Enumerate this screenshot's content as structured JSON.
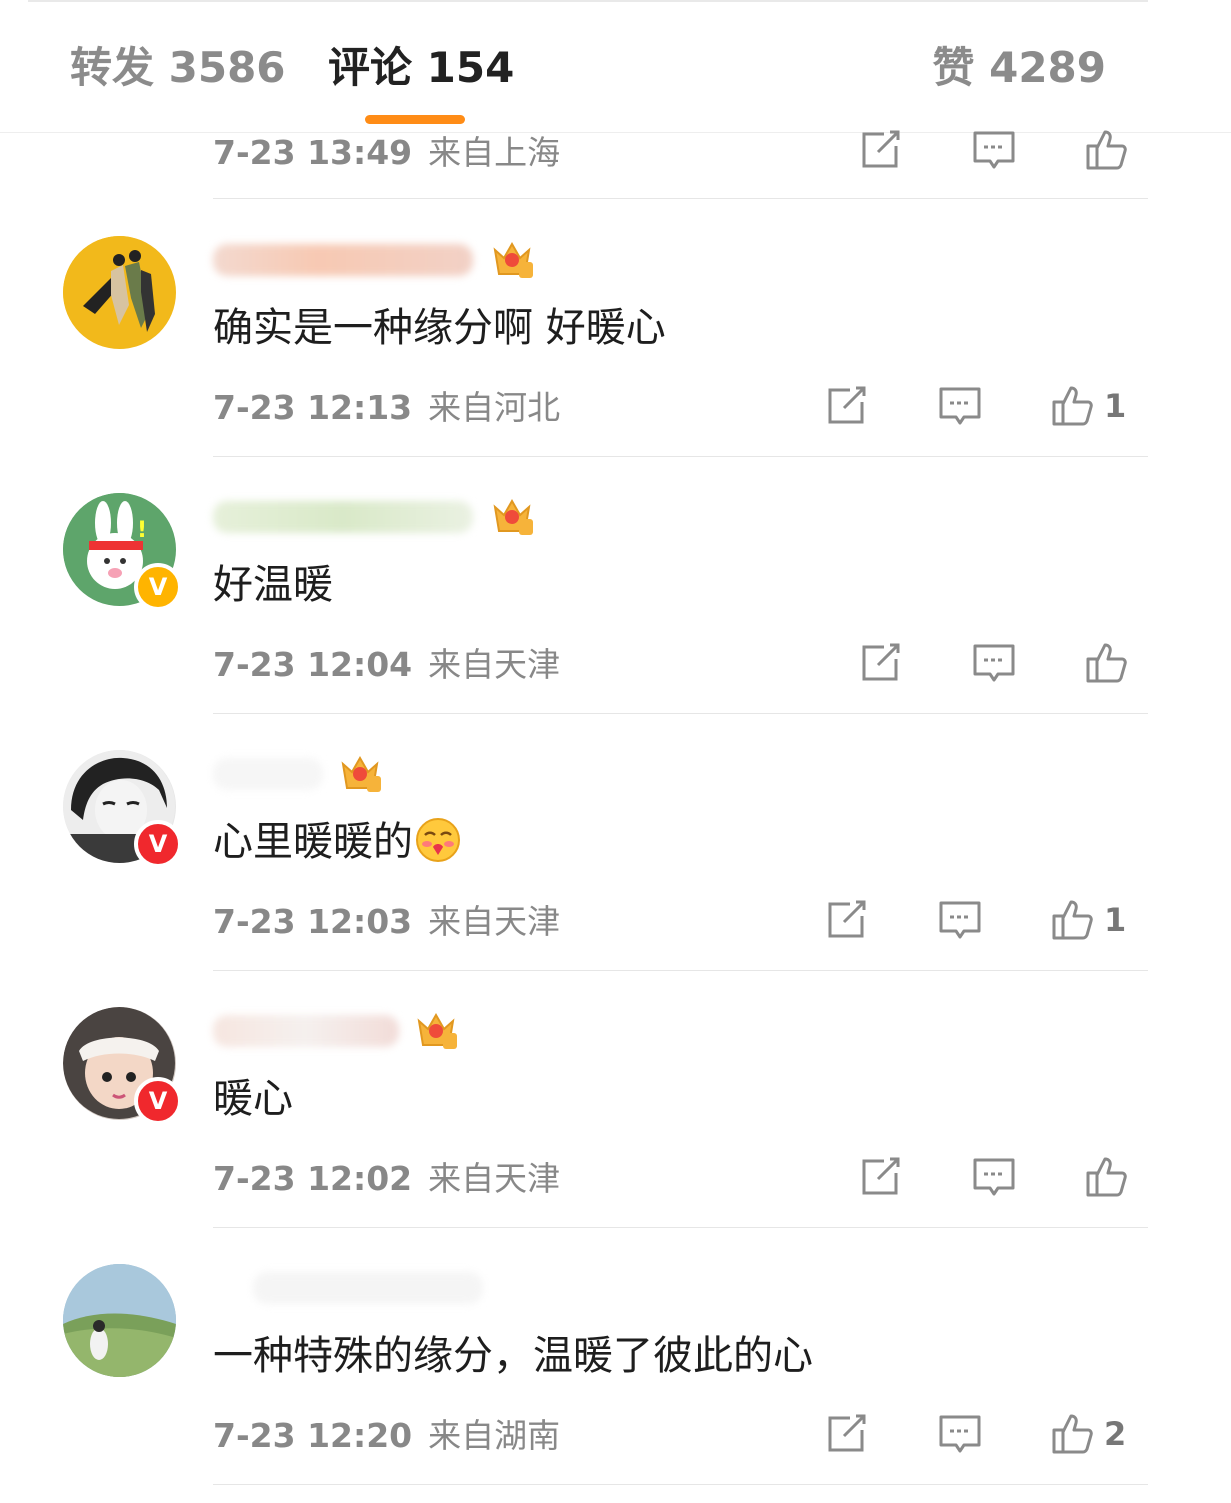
{
  "tabs": {
    "repost": "转发 3586",
    "comments": "评论 154",
    "likes": "赞 4289"
  },
  "accent_color": "#ff8c16",
  "partial_comment": {
    "time": "7-23 13:49",
    "location": "来自上海"
  },
  "comments": [
    {
      "text": "确实是一种缘分啊 好暖心",
      "time": "7-23 12:13",
      "location": "来自河北",
      "likes": "1",
      "crown_level": "1"
    },
    {
      "text": "好温暖",
      "time": "7-23 12:04",
      "location": "来自天津",
      "likes": "",
      "crown_level": "5",
      "verified": "V"
    },
    {
      "text": "心里暖暖的",
      "time": "7-23 12:03",
      "location": "来自天津",
      "likes": "1",
      "crown_level": "7",
      "verified": "V",
      "emoji": "warm-heart-face"
    },
    {
      "text": "暖心",
      "time": "7-23 12:02",
      "location": "来自天津",
      "likes": "",
      "crown_level": "6",
      "verified": "V"
    },
    {
      "text": "一种特殊的缘分，温暖了彼此的心",
      "time": "7-23 12:20",
      "location": "来自湖南",
      "likes": "2"
    }
  ]
}
